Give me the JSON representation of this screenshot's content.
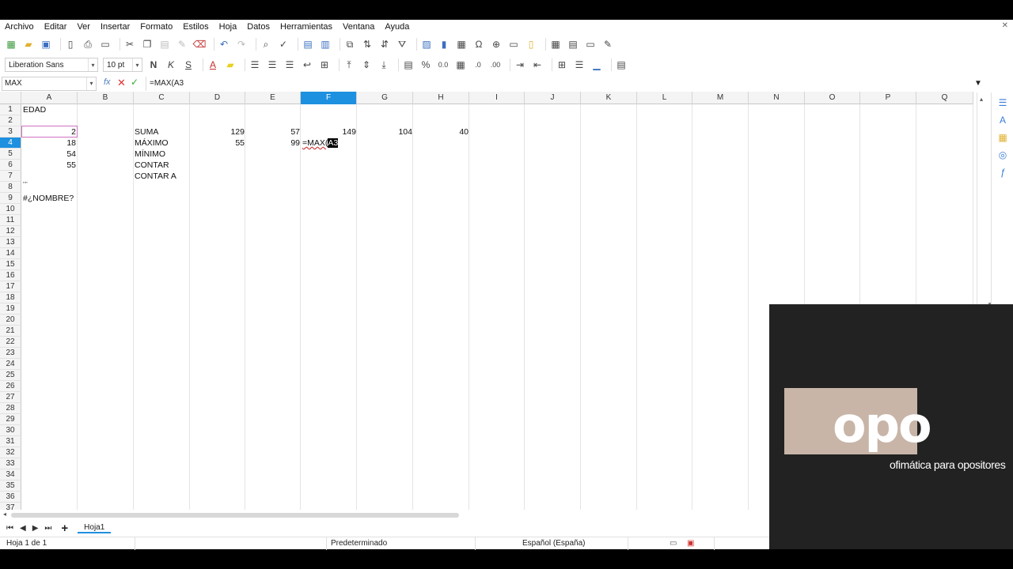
{
  "menu": [
    "Archivo",
    "Editar",
    "Ver",
    "Insertar",
    "Formato",
    "Estilos",
    "Hoja",
    "Datos",
    "Herramientas",
    "Ventana",
    "Ayuda"
  ],
  "toolbar": {
    "font_name": "Liberation Sans",
    "font_size": "10 pt",
    "bold_label": "N",
    "italic_label": "K",
    "underline_label": "S",
    "font_color_label": "A",
    "percent_label": "%",
    "decimal_label": "0.0",
    "decimal_remove_label": ".00",
    "decimal_add_label": ".0"
  },
  "formula_bar": {
    "name_box": "MAX",
    "fx_label": "fx",
    "cancel_label": "✕",
    "accept_label": "✓",
    "formula": "=MAX(A3"
  },
  "columns": [
    "A",
    "B",
    "C",
    "D",
    "E",
    "F",
    "G",
    "H",
    "I",
    "J",
    "K",
    "L",
    "M",
    "N",
    "O",
    "P",
    "Q"
  ],
  "selected_column": "F",
  "selected_row": "4",
  "rows": [
    "1",
    "2",
    "3",
    "4",
    "5",
    "6",
    "7",
    "8",
    "9",
    "10",
    "11",
    "12",
    "13",
    "14",
    "15",
    "16",
    "17",
    "18",
    "19",
    "20",
    "21",
    "22",
    "23",
    "24",
    "25",
    "26",
    "27",
    "28",
    "29",
    "30",
    "31",
    "32",
    "33",
    "34",
    "35",
    "36",
    "37"
  ],
  "cells": {
    "A1": "EDAD",
    "A3": "2",
    "A4": "18",
    "A5": "54",
    "A6": "55",
    "A8": "\"\"",
    "A9": "#¿NOMBRE?",
    "C3": "SUMA",
    "C4": "MÁXIMO",
    "C5": "MÍNIMO",
    "C6": "CONTAR",
    "C7": "CONTAR A",
    "D3": "129",
    "D4": "55",
    "E3": "57",
    "E4": "99",
    "F3": "149",
    "F4_prefix": "=MAX(",
    "F4_ref": "A3",
    "G3": "104",
    "H3": "40"
  },
  "sheet_tabs": {
    "add_label": "+",
    "tab": "Hoja1"
  },
  "status": {
    "sheet": "Hoja 1 de 1",
    "style": "Predeterminado",
    "language": "Español (España)"
  },
  "overlay": {
    "logo_text": "opo",
    "logo_sub": "ofimática para opositores"
  },
  "colors": {
    "selection": "#1e90e0",
    "reference_highlight": "#d070c0",
    "logo_box": "#c8b5a8"
  }
}
